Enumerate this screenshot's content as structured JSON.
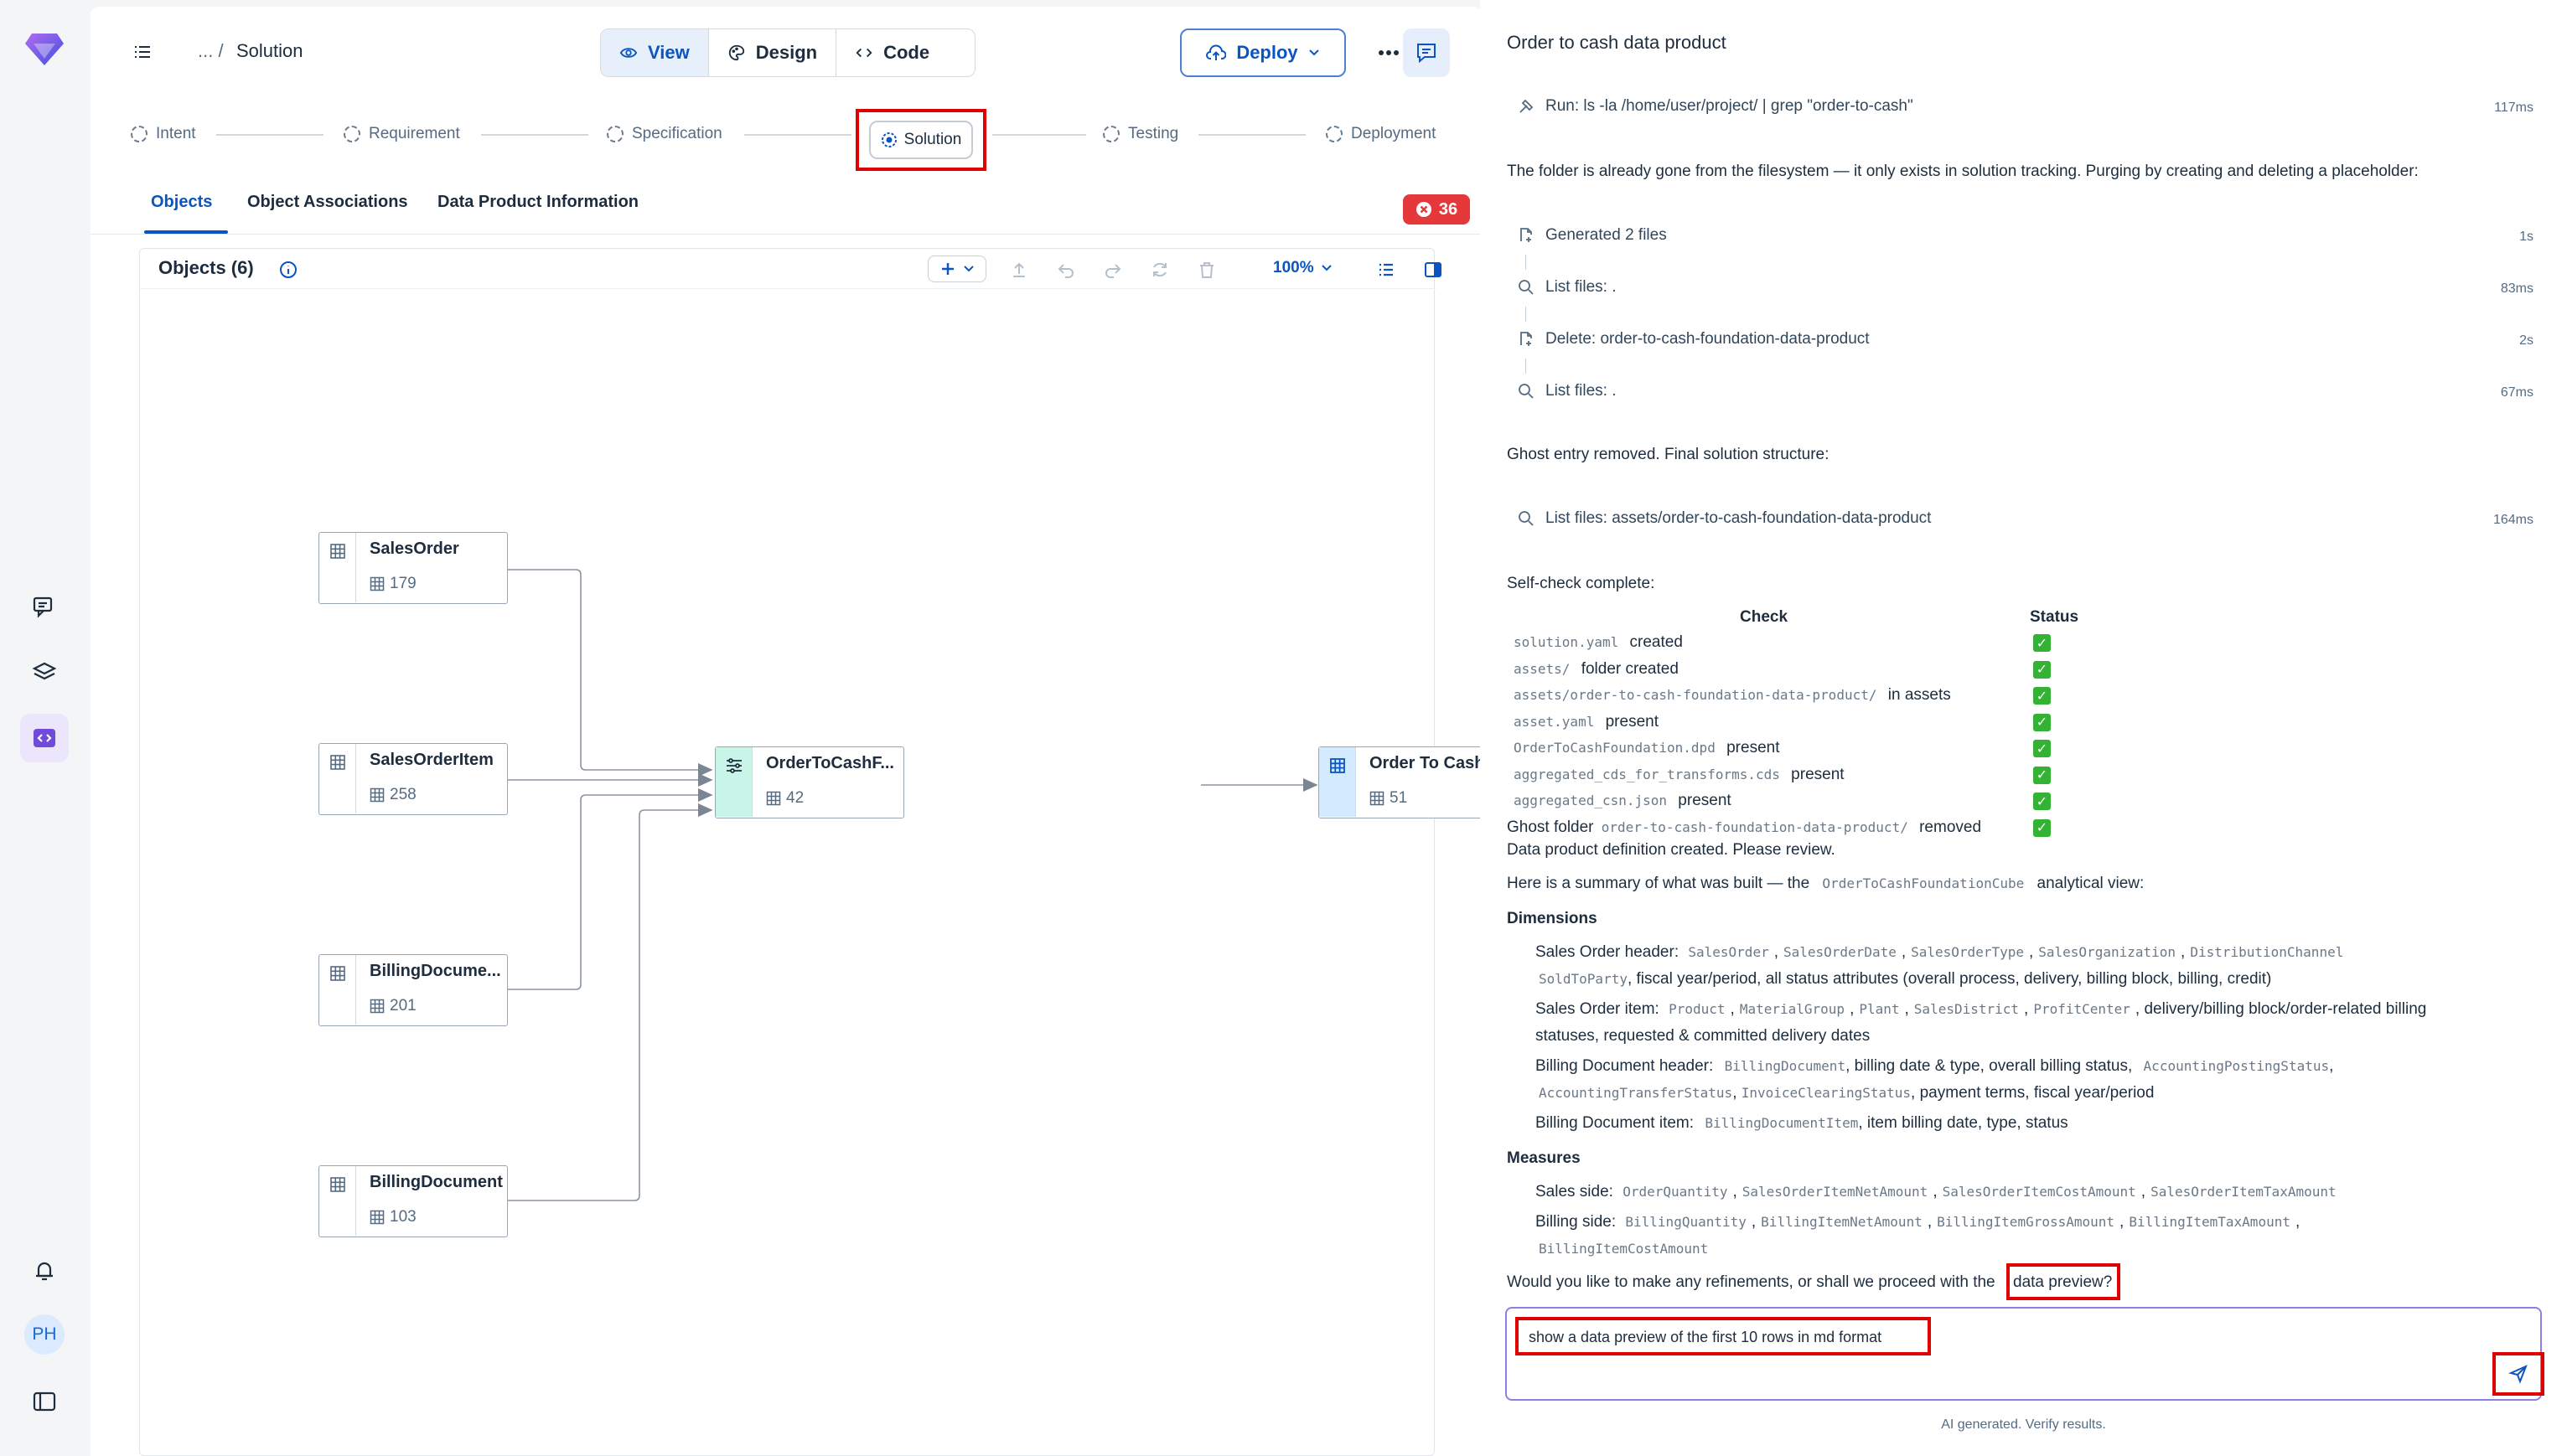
{
  "header": {
    "breadcrumb_prefix": "... /",
    "breadcrumb_current": "Solution",
    "view_label": "View",
    "design_label": "Design",
    "code_label": "Code",
    "deploy_label": "Deploy"
  },
  "stepper": {
    "steps": [
      "Intent",
      "Requirement",
      "Specification",
      "Solution",
      "Testing",
      "Deployment"
    ]
  },
  "tabs": {
    "items": [
      "Objects",
      "Object Associations",
      "Data Product Information"
    ],
    "error_count": "36"
  },
  "canvas": {
    "title": "Objects (6)",
    "zoom": "100%",
    "nodes": [
      {
        "name": "SalesOrder",
        "count": "179"
      },
      {
        "name": "SalesOrderItem",
        "count": "258"
      },
      {
        "name": "BillingDocume...",
        "count": "201"
      },
      {
        "name": "BillingDocument",
        "count": "103"
      },
      {
        "name": "OrderToCashF...",
        "count": "42"
      },
      {
        "name": "Order To Cash ...",
        "count": "51"
      }
    ]
  },
  "chat": {
    "title": "Order to cash data product",
    "run_cmd": "Run: ls -la /home/user/project/ | grep \"order-to-cash\"",
    "run_ms": "117ms",
    "msg1": "The folder is already gone from the filesystem — it only exists in solution tracking. Purging by creating and deleting a placeholder:",
    "tools": [
      {
        "label": "Generated 2 files",
        "time": "1s"
      },
      {
        "label": "List files: .",
        "time": "83ms"
      },
      {
        "label": "Delete: order-to-cash-foundation-data-product",
        "time": "2s"
      },
      {
        "label": "List files: .",
        "time": "67ms"
      }
    ],
    "msg2": "Ghost entry removed. Final solution structure:",
    "list_assets": "List files: assets/order-to-cash-foundation-data-product",
    "list_assets_ms": "164ms",
    "msg3": "Self-check complete:",
    "check_header": "Check",
    "status_header": "Status",
    "checks": [
      {
        "pre": "",
        "code": "solution.yaml",
        "post": "created"
      },
      {
        "pre": "",
        "code": "assets/",
        "post": "folder created"
      },
      {
        "pre": "",
        "code": "assets/order-to-cash-foundation-data-product/",
        "post": "in assets"
      },
      {
        "pre": "",
        "code": "asset.yaml",
        "post": "present"
      },
      {
        "pre": "",
        "code": "OrderToCashFoundation.dpd",
        "post": "present"
      },
      {
        "pre": "",
        "code": "aggregated_cds_for_transforms.cds",
        "post": "present"
      },
      {
        "pre": "",
        "code": "aggregated_csn.json",
        "post": "present"
      },
      {
        "pre": "Ghost folder",
        "code": "order-to-cash-foundation-data-product/",
        "post": "removed"
      }
    ],
    "msg4": "Data product definition created. Please review.",
    "summary_pre": "Here is a summary of what was built — the",
    "summary_code": "OrderToCashFoundationCube",
    "summary_post": "analytical view:",
    "dimensions_heading": "Dimensions",
    "dim_so_header_label": "Sales Order header:",
    "dim_so_header_codes": [
      "SalesOrder",
      "SalesOrderDate",
      "SalesOrderType",
      "SalesOrganization",
      "DistributionChannel"
    ],
    "dim_so_header_code2": "SoldToParty",
    "dim_so_header_rest": ", fiscal year/period, all status attributes (overall process, delivery, billing block, billing, credit)",
    "dim_so_item_label": "Sales Order item:",
    "dim_so_item_codes": [
      "Product",
      "MaterialGroup",
      "Plant",
      "SalesDistrict",
      "ProfitCenter"
    ],
    "dim_so_item_rest1": ", delivery/billing block/order-related billing",
    "dim_so_item_rest2": "statuses, requested & committed delivery dates",
    "dim_bd_header_label": "Billing Document header:",
    "dim_bd_header_code": "BillingDocument",
    "dim_bd_header_mid": ", billing date & type, overall billing status,",
    "dim_bd_header_code2": "AccountingPostingStatus",
    "dim_bd_header_code3": "AccountingTransferStatus",
    "dim_bd_header_code4": "InvoiceClearingStatus",
    "dim_bd_header_rest": ", payment terms, fiscal year/period",
    "dim_bd_item_label": "Billing Document item:",
    "dim_bd_item_code": "BillingDocumentItem",
    "dim_bd_item_rest": ", item billing date, type, status",
    "measures_heading": "Measures",
    "measures_sales_label": "Sales side:",
    "measures_sales_codes": [
      "OrderQuantity",
      "SalesOrderItemNetAmount",
      "SalesOrderItemCostAmount",
      "SalesOrderItemTaxAmount"
    ],
    "measures_billing_label": "Billing side:",
    "measures_billing_codes": [
      "BillingQuantity",
      "BillingItemNetAmount",
      "BillingItemGrossAmount",
      "BillingItemTaxAmount"
    ],
    "measures_billing_code2": "BillingItemCostAmount",
    "question_pre": "Would you like to make any refinements, or shall we proceed with the",
    "question_link": "data preview?",
    "input_value": "show a data preview of the first 10 rows in md format",
    "footer": "AI generated. Verify results."
  },
  "colors": {
    "accent": "#0a55c2",
    "highlight_red": "#e00000",
    "error_badge": "#e5383b",
    "check_green": "#34b233",
    "brand_purple": "#6e4bd8"
  }
}
